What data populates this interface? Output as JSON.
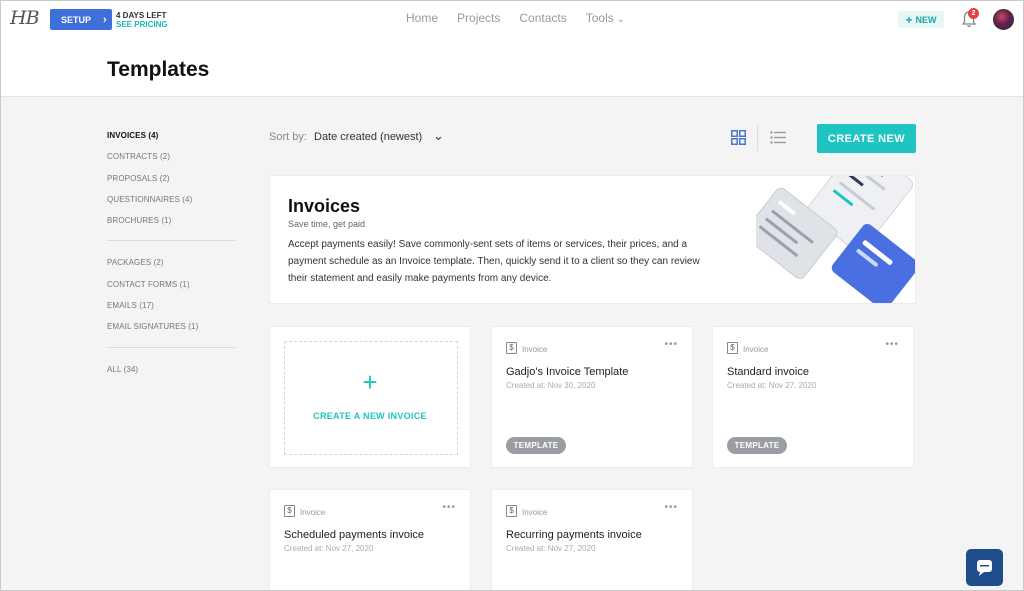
{
  "nav": {
    "logo": "HB",
    "setup_label": "SETUP",
    "trial_days": "4 DAYS LEFT",
    "trial_pricing": "SEE PRICING",
    "links": [
      "Home",
      "Projects",
      "Contacts",
      "Tools"
    ],
    "new_label": "NEW",
    "notification_count": "2"
  },
  "page": {
    "title": "Templates"
  },
  "sidebar": {
    "group1": [
      "INVOICES (4)",
      "CONTRACTS (2)",
      "PROPOSALS (2)",
      "QUESTIONNAIRES (4)",
      "BROCHURES (1)"
    ],
    "group2": [
      "PACKAGES (2)",
      "CONTACT FORMS (1)",
      "EMAILS (17)",
      "EMAIL SIGNATURES (1)"
    ],
    "group3": [
      "ALL (34)"
    ]
  },
  "toolbar": {
    "sort_label": "Sort by:",
    "sort_value": "Date created (newest)",
    "create_new": "CREATE NEW"
  },
  "banner": {
    "title": "Invoices",
    "subtitle": "Save time, get paid",
    "description": "Accept payments easily! Save commonly-sent sets of items or services, their prices, and a payment schedule as an Invoice template. Then, quickly send it to a client so they can review their statement and easily make payments from any device."
  },
  "create_card": {
    "plus": "+",
    "label": "CREATE A NEW INVOICE"
  },
  "cards": [
    {
      "type": "Invoice",
      "name": "Gadjo's Invoice Template",
      "date": "Created at: Nov 30, 2020",
      "tag": "TEMPLATE"
    },
    {
      "type": "Invoice",
      "name": "Standard invoice",
      "date": "Created at: Nov 27, 2020",
      "tag": "TEMPLATE"
    },
    {
      "type": "Invoice",
      "name": "Scheduled payments invoice",
      "date": "Created at: Nov 27, 2020",
      "tag": ""
    },
    {
      "type": "Invoice",
      "name": "Recurring payments invoice",
      "date": "Created at: Nov 27, 2020",
      "tag": ""
    }
  ],
  "colors": {
    "accent": "#1ec4c2",
    "setup_blue": "#3f6fd8",
    "badge_red": "#e0424c",
    "chat_navy": "#1f4d8c"
  }
}
